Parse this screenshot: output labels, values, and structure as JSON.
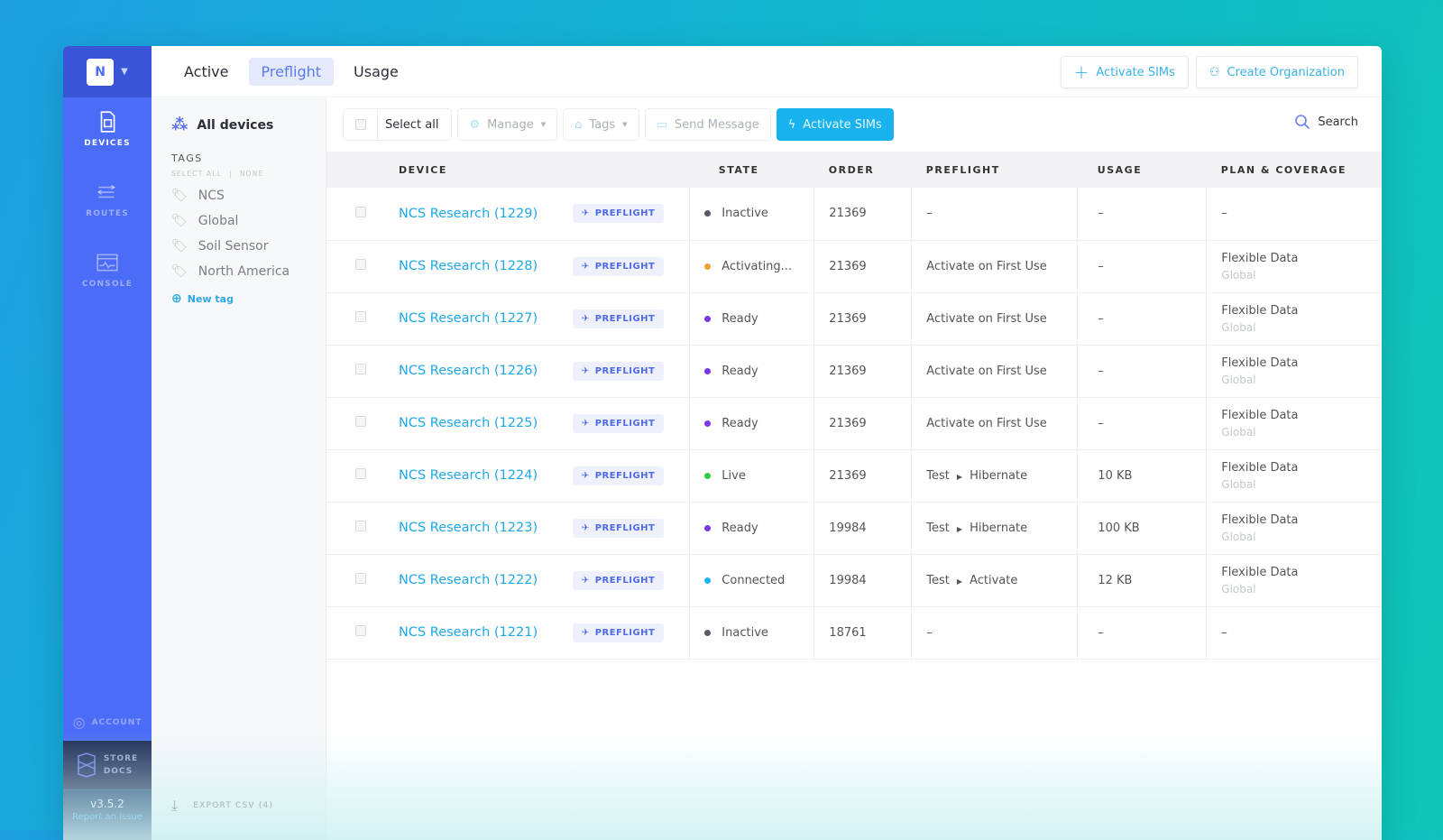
{
  "org": {
    "initial": "N"
  },
  "nav": {
    "items": [
      {
        "label": "DEVICES"
      },
      {
        "label": "ROUTES"
      },
      {
        "label": "CONSOLE"
      }
    ],
    "account": "ACCOUNT",
    "store": "STORE",
    "docs": "DOCS",
    "version": "v3.5.2",
    "report": "Report an issue"
  },
  "tabs": [
    {
      "label": "Active"
    },
    {
      "label": "Preflight"
    },
    {
      "label": "Usage"
    }
  ],
  "header": {
    "activate": "Activate SIMs",
    "create_org": "Create Organization"
  },
  "tags": {
    "all": "All devices",
    "heading": "TAGS",
    "select_all": "SELECT ALL",
    "none": "NONE",
    "items": [
      "NCS",
      "Global",
      "Soil Sensor",
      "North America"
    ],
    "new_tag": "New tag",
    "export": "EXPORT CSV (4)"
  },
  "toolbar": {
    "select_all": "Select all",
    "manage": "Manage",
    "tags": "Tags",
    "send": "Send Message",
    "activate": "Activate SIMs",
    "search": "Search"
  },
  "columns": [
    "DEVICE",
    "STATE",
    "ORDER",
    "PREFLIGHT",
    "USAGE",
    "PLAN & COVERAGE"
  ],
  "badge": "PREFLIGHT",
  "colors": {
    "Inactive": "#555b66",
    "Activating...": "#f0a030",
    "Ready": "#7a35e8",
    "Live": "#2ecc40",
    "Connected": "#1eb4ee"
  },
  "rows": [
    {
      "device": "NCS Research (1229)",
      "state": "Inactive",
      "order": "21369",
      "pf": "–",
      "pf2": "",
      "usage": "–",
      "plan": "–",
      "cov": ""
    },
    {
      "device": "NCS Research (1228)",
      "state": "Activating...",
      "order": "21369",
      "pf": "Activate on First Use",
      "pf2": "",
      "usage": "–",
      "plan": "Flexible Data",
      "cov": "Global"
    },
    {
      "device": "NCS Research (1227)",
      "state": "Ready",
      "order": "21369",
      "pf": "Activate on First Use",
      "pf2": "",
      "usage": "–",
      "plan": "Flexible Data",
      "cov": "Global"
    },
    {
      "device": "NCS Research (1226)",
      "state": "Ready",
      "order": "21369",
      "pf": "Activate on First Use",
      "pf2": "",
      "usage": "–",
      "plan": "Flexible Data",
      "cov": "Global"
    },
    {
      "device": "NCS Research (1225)",
      "state": "Ready",
      "order": "21369",
      "pf": "Activate on First Use",
      "pf2": "",
      "usage": "–",
      "plan": "Flexible Data",
      "cov": "Global"
    },
    {
      "device": "NCS Research (1224)",
      "state": "Live",
      "order": "21369",
      "pf": "Test",
      "pf2": "Hibernate",
      "usage": "10 KB",
      "plan": "Flexible Data",
      "cov": "Global"
    },
    {
      "device": "NCS Research (1223)",
      "state": "Ready",
      "order": "19984",
      "pf": "Test",
      "pf2": "Hibernate",
      "usage": "100 KB",
      "plan": "Flexible Data",
      "cov": "Global"
    },
    {
      "device": "NCS Research (1222)",
      "state": "Connected",
      "order": "19984",
      "pf": "Test",
      "pf2": "Activate",
      "usage": "12 KB",
      "plan": "Flexible Data",
      "cov": "Global"
    },
    {
      "device": "NCS Research (1221)",
      "state": "Inactive",
      "order": "18761",
      "pf": "–",
      "pf2": "",
      "usage": "–",
      "plan": "–",
      "cov": ""
    }
  ]
}
